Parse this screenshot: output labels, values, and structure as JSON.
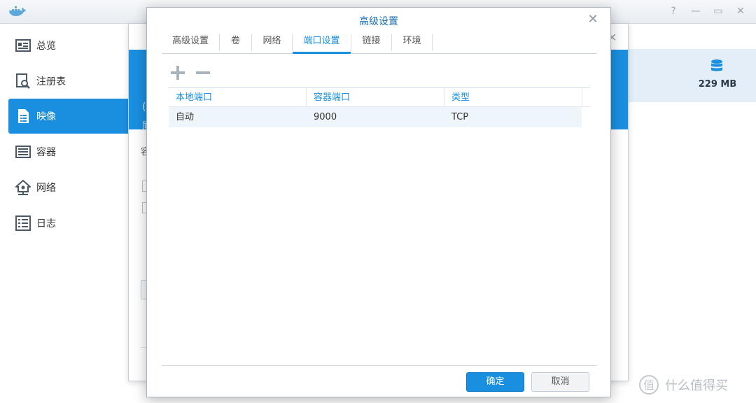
{
  "app": {
    "window_controls": [
      "?",
      "—",
      "▭",
      "✕"
    ]
  },
  "sidebar": {
    "items": [
      {
        "label": "总览",
        "icon": "overview-icon",
        "active": false
      },
      {
        "label": "注册表",
        "icon": "registry-icon",
        "active": false
      },
      {
        "label": "映像",
        "icon": "image-icon",
        "active": true
      },
      {
        "label": "容器",
        "icon": "container-icon",
        "active": false
      },
      {
        "label": "网络",
        "icon": "network-icon",
        "active": false
      },
      {
        "label": "日志",
        "icon": "log-icon",
        "active": false
      }
    ]
  },
  "storage": {
    "size": "229 MB"
  },
  "background_window": {
    "text_a": "(",
    "text_b": "同",
    "label": "容"
  },
  "dialog": {
    "title": "高级设置",
    "tabs": [
      {
        "label": "高级设置",
        "active": false
      },
      {
        "label": "卷",
        "active": false
      },
      {
        "label": "网络",
        "active": false
      },
      {
        "label": "端口设置",
        "active": true
      },
      {
        "label": "链接",
        "active": false
      },
      {
        "label": "环境",
        "active": false
      }
    ],
    "table": {
      "headers": [
        "本地端口",
        "容器端口",
        "类型"
      ],
      "rows": [
        [
          "自动",
          "9000",
          "TCP"
        ]
      ]
    },
    "ok_label": "确定",
    "cancel_label": "取消"
  },
  "watermark": {
    "text": "什么值得买"
  },
  "colors": {
    "accent": "#1a8fe0",
    "header_text": "#1a8fe0"
  }
}
